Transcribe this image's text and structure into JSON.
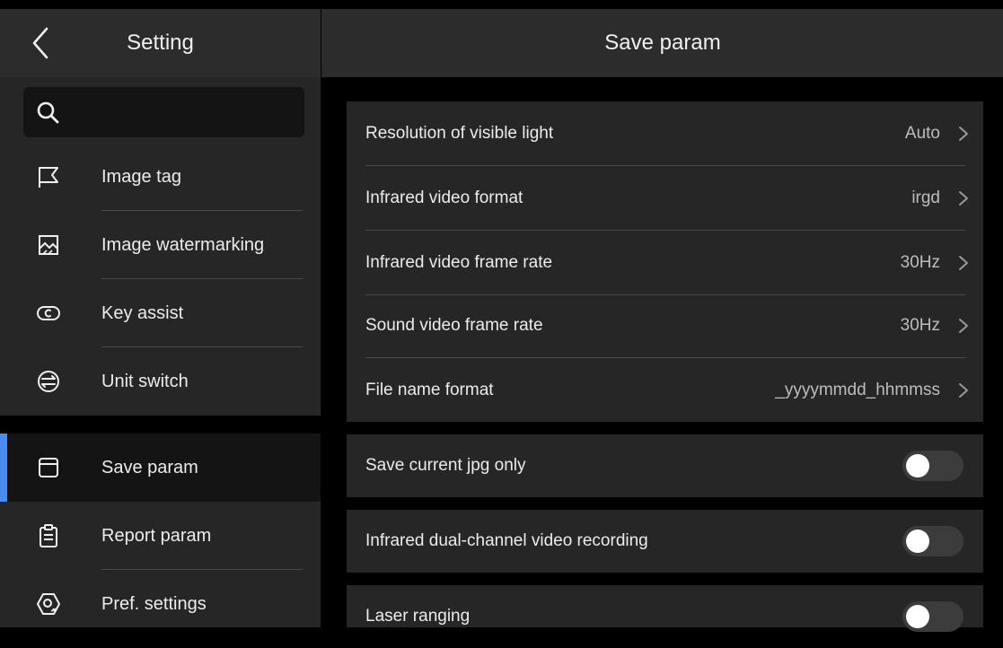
{
  "sidebar": {
    "title": "Setting",
    "search": {
      "placeholder": ""
    },
    "items": [
      {
        "label": "Image tag",
        "icon": "flag-icon"
      },
      {
        "label": "Image watermarking",
        "icon": "image-watermark-icon"
      },
      {
        "label": "Key assist",
        "icon": "key-assist-icon"
      },
      {
        "label": "Unit switch",
        "icon": "unit-switch-icon"
      }
    ],
    "items2": [
      {
        "label": "Save param",
        "icon": "save-icon",
        "active": true
      },
      {
        "label": "Report param",
        "icon": "clipboard-icon"
      },
      {
        "label": "Pref. settings",
        "icon": "pref-settings-icon"
      }
    ]
  },
  "main": {
    "title": "Save param",
    "settings": [
      {
        "label": "Resolution of visible light",
        "value": "Auto"
      },
      {
        "label": "Infrared video format",
        "value": "irgd"
      },
      {
        "label": "Infrared video frame rate",
        "value": "30Hz"
      },
      {
        "label": "Sound video frame rate",
        "value": "30Hz"
      },
      {
        "label": "File name format",
        "value": "_yyyymmdd_hhmmss"
      }
    ],
    "toggles": [
      {
        "label": "Save current jpg only",
        "on": false
      },
      {
        "label": "Infrared dual-channel video recording",
        "on": false
      },
      {
        "label": "Laser ranging",
        "on": false
      }
    ]
  },
  "colors": {
    "accent": "#4a8cf0",
    "panel": "#262626",
    "header": "#2c2c2c"
  }
}
